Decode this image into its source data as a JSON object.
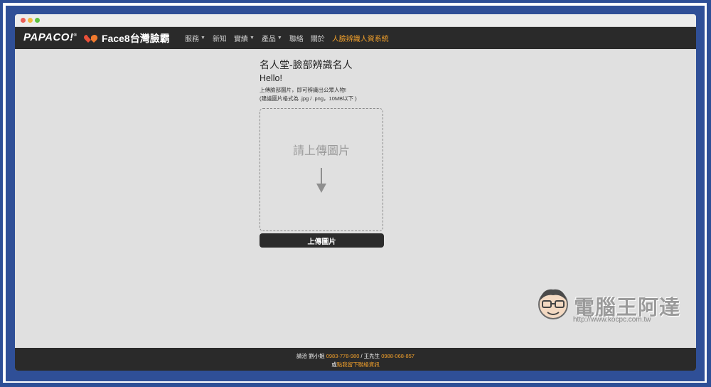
{
  "nav": {
    "brand": "PAPACO!",
    "brand_registered": "®",
    "product": "Face8台灣臉霸",
    "items": [
      {
        "label": "服務",
        "caret": true
      },
      {
        "label": "新知",
        "caret": false
      },
      {
        "label": "實績",
        "caret": true
      },
      {
        "label": "產品",
        "caret": true
      },
      {
        "label": "聯絡",
        "caret": false
      },
      {
        "label": "關於",
        "caret": false
      },
      {
        "label": "人臉辨識人資系統",
        "caret": false
      }
    ]
  },
  "main": {
    "title": "名人堂-臉部辨識名人",
    "hello": "Hello!",
    "desc_line1": "上傳臉部圖片，即可辨識出公眾人物!",
    "desc_line2": "(建議圖片格式為 .jpg / .png，10MB以下 )",
    "dropzone_text": "請上傳圖片",
    "upload_button": "上傳圖片"
  },
  "footer": {
    "contact_prefix": "請洽 劉小姐 ",
    "phone1": "0983-778-980",
    "separator": " / 王先生 ",
    "phone2": "0988-068-857",
    "line2_prefix": "或",
    "line2_link": "點我留下聯絡資訊"
  },
  "watermark": {
    "text": "電腦王阿達",
    "url": "http://www.kocpc.com.tw"
  },
  "colors": {
    "accent": "#f2a02b",
    "navbar": "#2a2a2a",
    "page_bg": "#e0e0e0",
    "frame": "#2f4f97"
  }
}
